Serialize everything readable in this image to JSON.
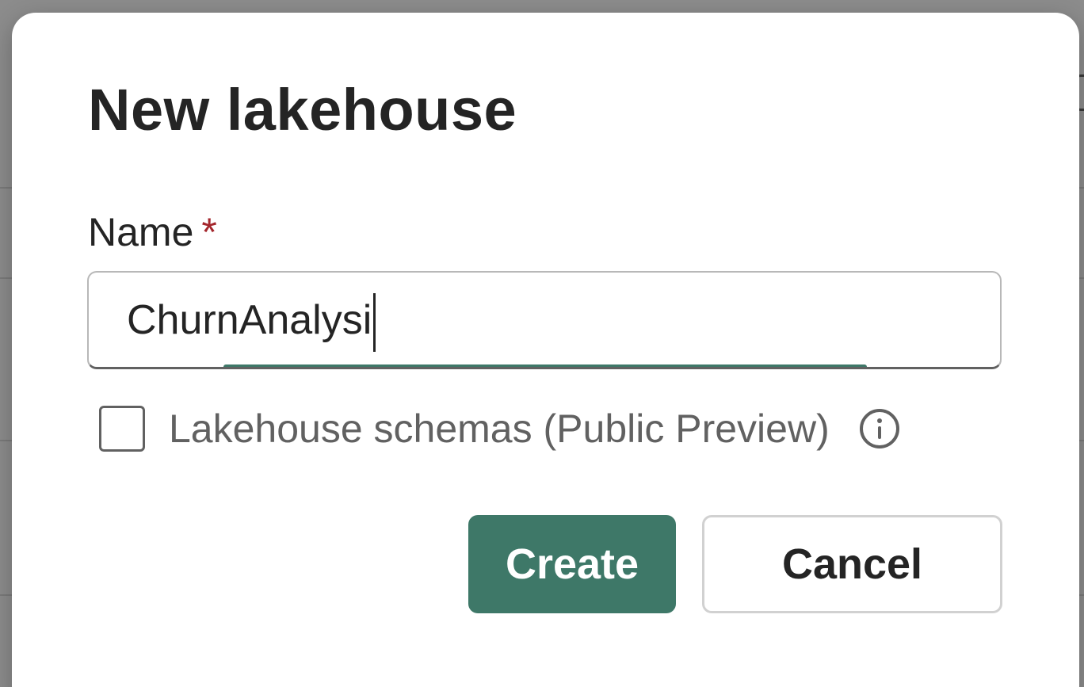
{
  "dialog": {
    "title": "New lakehouse",
    "name_field": {
      "label": "Name",
      "required_marker": "*",
      "value": "ChurnAnalysi"
    },
    "schemas_checkbox": {
      "label": "Lakehouse schemas (Public Preview)",
      "checked": false,
      "info_icon": "info-icon"
    },
    "buttons": {
      "create_label": "Create",
      "cancel_label": "Cancel"
    }
  },
  "colors": {
    "primary": "#3e7868",
    "required": "#a4262c",
    "text": "#242424",
    "secondary_text": "#616161"
  }
}
